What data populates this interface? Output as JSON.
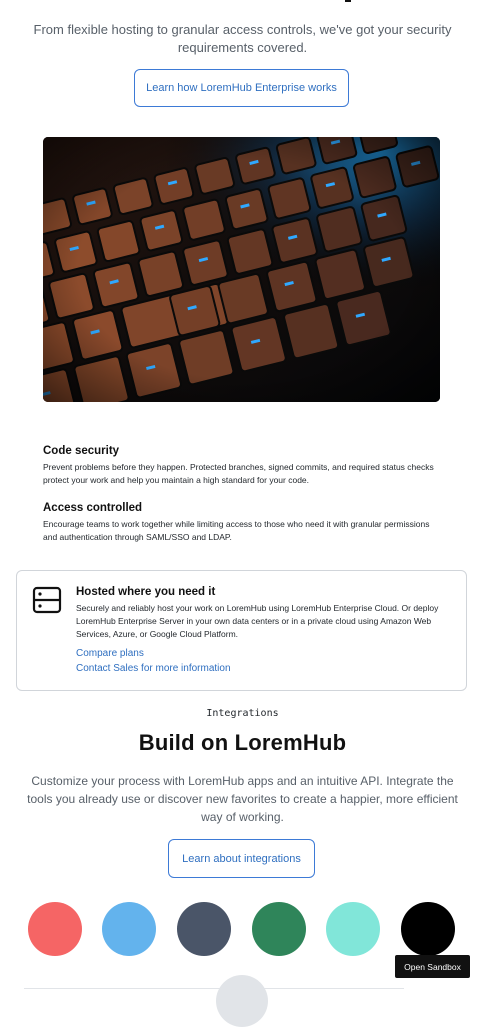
{
  "intro": {
    "text": "From flexible hosting to granular access controls, we've got your security requirements covered.",
    "cta_label": "Learn how LoremHub Enterprise works"
  },
  "hero_image": {
    "subject": "backlit-keyboard-photo"
  },
  "features": [
    {
      "title": "Code security",
      "description": "Prevent problems before they happen. Protected branches, signed commits, and required status checks protect your work and help you maintain a high standard for your code."
    },
    {
      "title": "Access controlled",
      "description": "Encourage teams to work together while limiting access to those who need it with granular permissions and authentication through SAML/SSO and LDAP."
    }
  ],
  "hosted": {
    "icon": "server-icon",
    "title": "Hosted where you need it",
    "description": "Securely and reliably host your work on LoremHub using LoremHub Enterprise Cloud. Or deploy LoremHub Enterprise Server in your own data centers or in a private cloud using Amazon Web Services, Azure, or Google Cloud Platform.",
    "links": [
      "Compare plans",
      "Contact Sales for more information"
    ]
  },
  "integrations": {
    "eyebrow": "Integrations",
    "heading": "Build on LoremHub",
    "description": "Customize your process with LoremHub apps and an intuitive API. Integrate the tools you already use or discover new favorites to create a happier, more efficient way of working.",
    "cta_label": "Learn about integrations",
    "swatches": [
      "#f56565",
      "#63b3ed",
      "#4a5568",
      "#2f855a",
      "#81e6d9",
      "#000000"
    ]
  },
  "sandbox": {
    "label": "Open Sandbox"
  },
  "colors": {
    "link": "#2f6fc0",
    "border": "#3d7ad6",
    "text_muted": "#586069"
  }
}
